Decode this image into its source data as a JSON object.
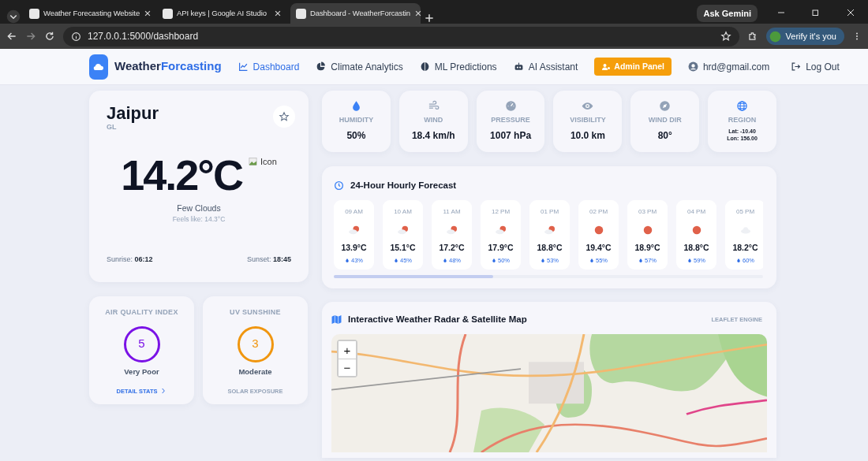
{
  "browser": {
    "tabs": [
      {
        "title": "Weather Forecasting Website",
        "selected": false
      },
      {
        "title": "API keys | Google AI Studio",
        "selected": false
      },
      {
        "title": "Dashboard - WeatherForcastin",
        "selected": true
      }
    ],
    "ask_button": "Ask Gemini",
    "address": "127.0.0.1:5000/dashboard",
    "profile_button": "Verify it's you"
  },
  "navbar": {
    "brand_parts": [
      "Weather",
      "Forcasting"
    ],
    "links": [
      {
        "label": "Dashboard",
        "selected": true
      },
      {
        "label": "Climate Analytics",
        "selected": false
      },
      {
        "label": "ML Predictions",
        "selected": false
      },
      {
        "label": "AI Assistant",
        "selected": false
      }
    ],
    "admin_button": "Admin Panel",
    "user": "hrd@gmail.com",
    "logout": "Log Out"
  },
  "current": {
    "city": "Jaipur",
    "country": "GL",
    "temperature": "14.2°C",
    "icon_alt": "Icon",
    "condition": "Few Clouds",
    "feels_like": "Feels like: 14.3°C",
    "sunrise_label": "Sunrise:",
    "sunrise": "06:12",
    "sunset_label": "Sunset:",
    "sunset": "18:45",
    "favorite": false
  },
  "stats": [
    {
      "kind": "humidity",
      "label": "HUMIDITY",
      "value": "50%"
    },
    {
      "kind": "wind",
      "label": "WIND",
      "value": "18.4 km/h"
    },
    {
      "kind": "pressure",
      "label": "PRESSURE",
      "value": "1007 hPa"
    },
    {
      "kind": "visibility",
      "label": "VISIBILITY",
      "value": "10.0 km"
    },
    {
      "kind": "direction",
      "label": "WIND DIR",
      "value": "80°"
    },
    {
      "kind": "region",
      "label": "REGION",
      "lines": [
        "Lat: -10.40",
        "Lon: 156.00"
      ]
    }
  ],
  "gauges": [
    {
      "title": "AIR QUALITY INDEX",
      "value": "5",
      "rating": "Very Poor",
      "color": "#7a12e6",
      "footer": "DETAIL STATS"
    },
    {
      "title": "UV SUNSHINE",
      "value": "3",
      "rating": "Moderate",
      "color": "#f0960f",
      "footer": "SOLAR EXPOSURE"
    }
  ],
  "hourly": {
    "title": "24-Hour Hourly Forecast",
    "items": [
      {
        "time": "09 AM",
        "kind": "partly",
        "temp": "13.9°C",
        "humidity": "43%"
      },
      {
        "time": "10 AM",
        "kind": "partly",
        "temp": "15.1°C",
        "humidity": "45%"
      },
      {
        "time": "11 AM",
        "kind": "partly",
        "temp": "17.2°C",
        "humidity": "48%"
      },
      {
        "time": "12 PM",
        "kind": "partly",
        "temp": "17.9°C",
        "humidity": "50%"
      },
      {
        "time": "01 PM",
        "kind": "partly",
        "temp": "18.8°C",
        "humidity": "53%"
      },
      {
        "time": "02 PM",
        "kind": "sun",
        "temp": "19.4°C",
        "humidity": "55%"
      },
      {
        "time": "03 PM",
        "kind": "sun",
        "temp": "18.9°C",
        "humidity": "57%"
      },
      {
        "time": "04 PM",
        "kind": "sun",
        "temp": "18.8°C",
        "humidity": "59%"
      },
      {
        "time": "05 PM",
        "kind": "cloud",
        "temp": "18.2°C",
        "humidity": "60%"
      }
    ]
  },
  "map": {
    "title": "Interactive Weather Radar & Satellite Map",
    "engine": "LEAFLET ENGINE",
    "zoom_in": "+",
    "zoom_out": "−"
  }
}
